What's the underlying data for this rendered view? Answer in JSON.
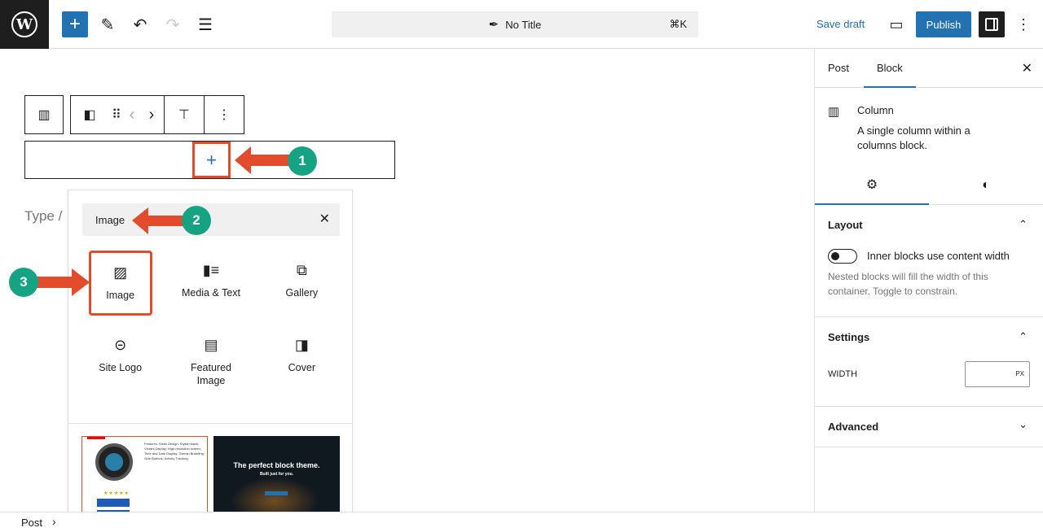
{
  "header": {
    "logo": "W",
    "add_icon": "+",
    "edit_icon": "✎",
    "undo_icon": "↶",
    "redo_icon": "↷",
    "list_icon": "☰",
    "doc_title": "No Title",
    "doc_icon": "✒",
    "shortcut": "⌘K",
    "save_draft": "Save draft",
    "view_icon": "▭",
    "publish": "Publish",
    "more_icon": "⋮"
  },
  "canvas": {
    "toolbar": {
      "columns_icon": "▥",
      "column_icon": "◧",
      "drag_icon": "⠿",
      "prev_icon": "‹",
      "next_icon": "›",
      "align_icon": "⊤",
      "more_icon": "⋮"
    },
    "appender_icon": "+",
    "placeholder": "Type /"
  },
  "inserter": {
    "search_value": "Image",
    "clear_icon": "✕",
    "blocks": [
      {
        "label": "Image",
        "icon": "▨"
      },
      {
        "label": "Media & Text",
        "icon": "▮≡"
      },
      {
        "label": "Gallery",
        "icon": "⧉"
      },
      {
        "label": "Site Logo",
        "icon": "⊝"
      },
      {
        "label": "Featured Image",
        "icon": "▤"
      },
      {
        "label": "Cover",
        "icon": "◨"
      }
    ],
    "pattern2_heading": "The perfect block theme.",
    "pattern2_sub": "Built just for you.",
    "pattern1_stars": "★★★★★",
    "pattern1_features": "Features: Sleek Design: Stylish black; Vibrant Display: High resolution screen; Time and Date Display; Garmin Branding; Side Buttons; Activity Tracking"
  },
  "annotations": [
    "1",
    "2",
    "3"
  ],
  "sidebar": {
    "tabs": [
      "Post",
      "Block"
    ],
    "close_icon": "✕",
    "block_icon": "▥",
    "block_title": "Column",
    "block_desc": "A single column within a columns block.",
    "settings_icon": "⚙",
    "styles_icon": "◐",
    "layout": {
      "title": "Layout",
      "toggle_label": "Inner blocks use content width",
      "help": "Nested blocks will fill the width of this container. Toggle to constrain."
    },
    "settings": {
      "title": "Settings",
      "width_label": "WIDTH",
      "unit": "PX"
    },
    "advanced": {
      "title": "Advanced"
    },
    "chevron_up": "⌃",
    "chevron_down": "⌄"
  },
  "footer": {
    "crumb": "Post",
    "sep": "›"
  },
  "colors": {
    "accent": "#2271b1",
    "annotation": "#e24b2c",
    "badge": "#15a383"
  }
}
